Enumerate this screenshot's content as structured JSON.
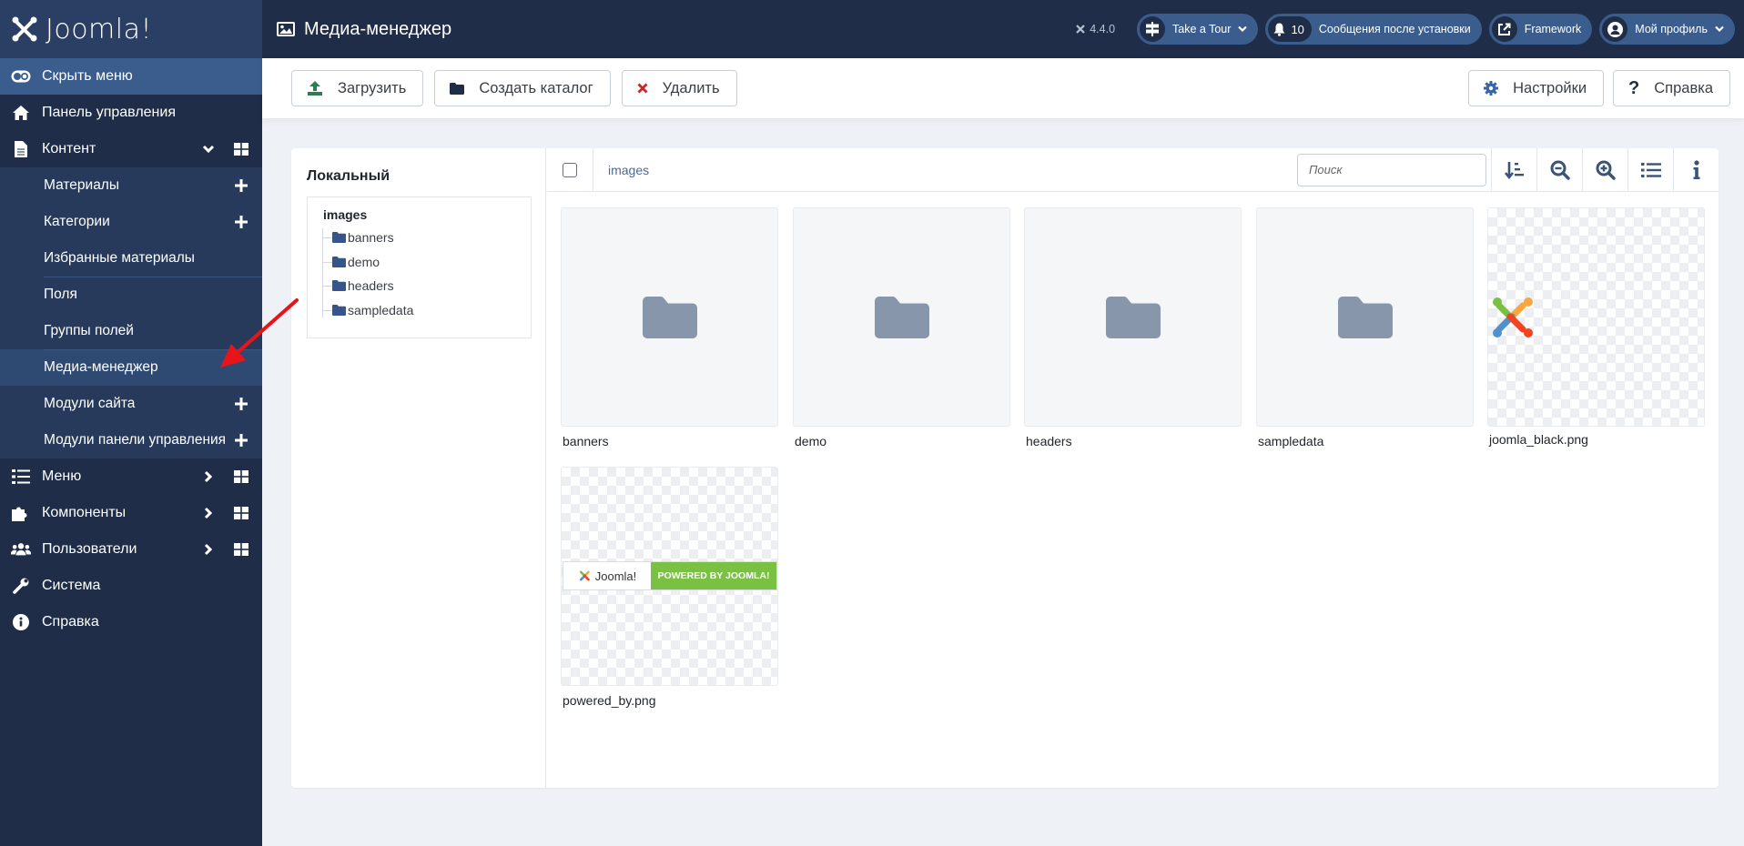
{
  "app": {
    "logo_text": "Joomla!",
    "version": "4.4.0"
  },
  "header": {
    "title": "Медиа-менеджер",
    "title_icon": "image-icon",
    "pills": [
      {
        "label": "Take a Tour",
        "icon": "signpost-icon",
        "has_caret": true
      },
      {
        "label": "Сообщения после установки",
        "icon": "bell-icon",
        "count": "10"
      },
      {
        "label": "Framework",
        "icon": "external-link-icon"
      },
      {
        "label": "Мой профиль",
        "icon": "user-circle-icon",
        "has_caret": true
      }
    ]
  },
  "sidebar": {
    "toggle_label": "Скрыть меню",
    "items": [
      {
        "label": "Панель управления",
        "icon": "home-icon"
      },
      {
        "label": "Контент",
        "icon": "file-icon",
        "expanded": true
      },
      {
        "label": "Меню",
        "icon": "list-icon"
      },
      {
        "label": "Компоненты",
        "icon": "puzzle-icon"
      },
      {
        "label": "Пользователи",
        "icon": "users-icon"
      },
      {
        "label": "Система",
        "icon": "wrench-icon"
      },
      {
        "label": "Справка",
        "icon": "info-icon"
      }
    ],
    "content_submenu": [
      {
        "label": "Материалы",
        "plus": true
      },
      {
        "label": "Категории",
        "plus": true
      },
      {
        "label": "Избранные материалы"
      },
      {
        "label": "Поля"
      },
      {
        "label": "Группы полей"
      },
      {
        "label": "Медиа-менеджер",
        "active": true
      },
      {
        "label": "Модули сайта",
        "plus": true
      },
      {
        "label": "Модули панели управления",
        "plus": true
      }
    ]
  },
  "toolbar": {
    "upload": "Загрузить",
    "create_folder": "Создать каталог",
    "delete": "Удалить",
    "settings": "Настройки",
    "help": "Справка"
  },
  "colors": {
    "upload_icon": "#2f7d4f",
    "delete_icon": "#c52827",
    "settings_icon": "#3a64a8",
    "accent": "#3a5d8d"
  },
  "left_panel": {
    "title": "Локальный",
    "root": "images",
    "folders": [
      "banners",
      "demo",
      "headers",
      "sampledata"
    ]
  },
  "browser": {
    "breadcrumb": "images",
    "search_placeholder": "Поиск",
    "icon_buttons": [
      "sort-icon",
      "zoom-out-icon",
      "zoom-in-icon",
      "list-view-icon",
      "info-icon"
    ],
    "items": [
      {
        "name": "banners",
        "type": "folder"
      },
      {
        "name": "demo",
        "type": "folder"
      },
      {
        "name": "headers",
        "type": "folder"
      },
      {
        "name": "sampledata",
        "type": "folder"
      },
      {
        "name": "joomla_black.png",
        "type": "image"
      },
      {
        "name": "powered_by.png",
        "type": "image",
        "banner_left": "Joomla!",
        "banner_right": "POWERED BY JOOMLA!"
      }
    ]
  }
}
